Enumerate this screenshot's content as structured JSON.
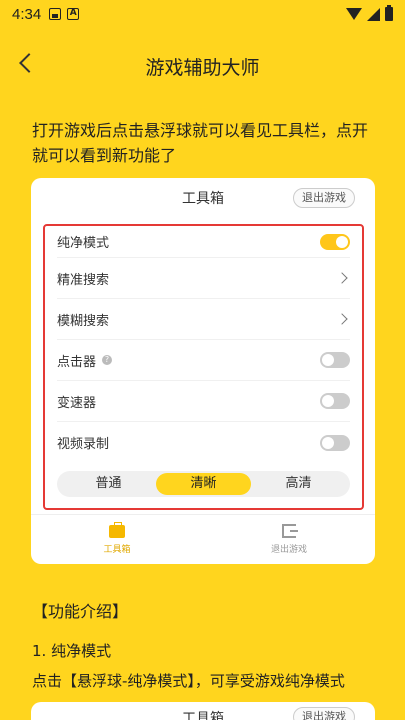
{
  "status": {
    "time": "4:34"
  },
  "header": {
    "title": "游戏辅助大师"
  },
  "intro": "打开游戏后点击悬浮球就可以看见工具栏，点开就可以看到新功能了",
  "card": {
    "title": "工具箱",
    "exit_button": "退出游戏",
    "rows": [
      {
        "label": "纯净模式",
        "control": "toggle",
        "on": true
      },
      {
        "label": "精准搜索",
        "control": "chevron"
      },
      {
        "label": "模糊搜索",
        "control": "chevron"
      },
      {
        "label": "点击器",
        "control": "toggle",
        "on": false,
        "help": "?"
      },
      {
        "label": "变速器",
        "control": "toggle",
        "on": false
      },
      {
        "label": "视频录制",
        "control": "toggle",
        "on": false
      }
    ],
    "quality": [
      "普通",
      "清晰",
      "高清"
    ],
    "quality_selected": "清晰",
    "nav": [
      {
        "label": "工具箱",
        "icon": "toolbox-icon",
        "active": true
      },
      {
        "label": "退出游戏",
        "icon": "exit-icon",
        "active": false
      }
    ]
  },
  "section": {
    "heading": "【功能介绍】",
    "sub": "1. 纯净模式",
    "desc": "点击【悬浮球-纯净模式】，可享受游戏纯净模式"
  },
  "card2": {
    "title": "工具箱",
    "exit_button": "退出游戏"
  },
  "colors": {
    "background": "#FFD51E",
    "highlight_border": "#E53935",
    "toggle_on": "#FFC61A"
  }
}
